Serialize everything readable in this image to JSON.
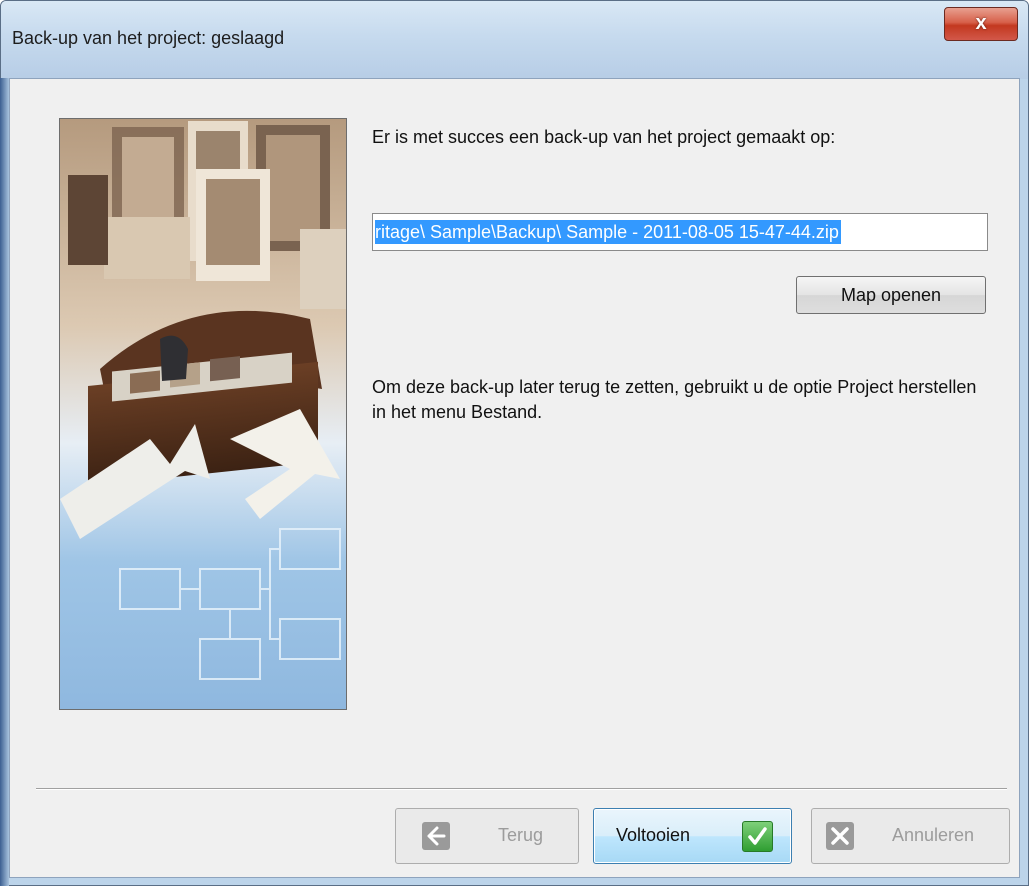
{
  "window": {
    "title": "Back-up van het project: geslaagd",
    "close_label": "x"
  },
  "content": {
    "success_message": "Er is met succes een back-up van het project gemaakt op:",
    "backup_path": "ritage\\ Sample\\Backup\\ Sample - 2011-08-05 15-47-44.zip",
    "open_folder_label": "Map openen",
    "restore_hint": "Om deze back-up later terug te zetten, gebruikt u de optie Project herstellen in het menu Bestand."
  },
  "buttons": {
    "back_label": "Terug",
    "finish_label": "Voltooien",
    "cancel_label": "Annuleren"
  },
  "icons": {
    "close": "close-icon",
    "back": "arrow-left-icon",
    "finish": "checkmark-icon",
    "cancel": "x-icon",
    "illustration": "treasure-chest-photos-illustration"
  },
  "colors": {
    "selection": "#3399ff",
    "close_button": "#c3381f",
    "default_button": "#bee6fd",
    "check_icon": "#2f9e32"
  }
}
